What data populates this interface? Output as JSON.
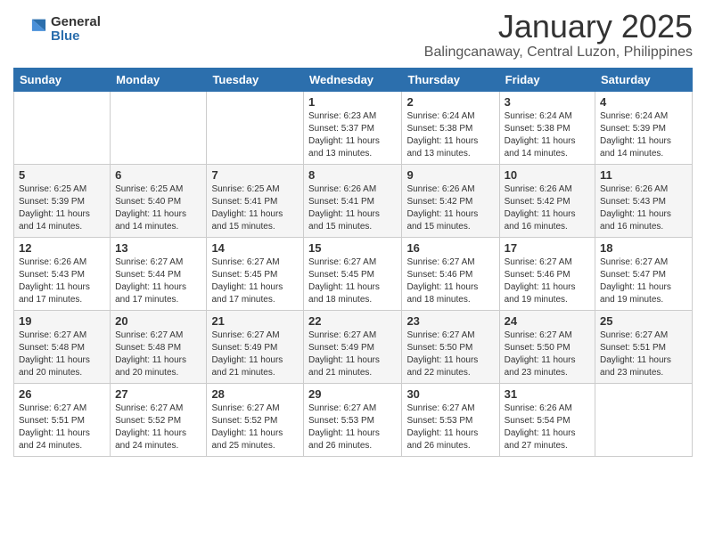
{
  "logo": {
    "general": "General",
    "blue": "Blue"
  },
  "title": "January 2025",
  "subtitle": "Balingcanaway, Central Luzon, Philippines",
  "weekdays": [
    "Sunday",
    "Monday",
    "Tuesday",
    "Wednesday",
    "Thursday",
    "Friday",
    "Saturday"
  ],
  "weeks": [
    [
      {
        "day": "",
        "info": ""
      },
      {
        "day": "",
        "info": ""
      },
      {
        "day": "",
        "info": ""
      },
      {
        "day": "1",
        "info": "Sunrise: 6:23 AM\nSunset: 5:37 PM\nDaylight: 11 hours\nand 13 minutes."
      },
      {
        "day": "2",
        "info": "Sunrise: 6:24 AM\nSunset: 5:38 PM\nDaylight: 11 hours\nand 13 minutes."
      },
      {
        "day": "3",
        "info": "Sunrise: 6:24 AM\nSunset: 5:38 PM\nDaylight: 11 hours\nand 14 minutes."
      },
      {
        "day": "4",
        "info": "Sunrise: 6:24 AM\nSunset: 5:39 PM\nDaylight: 11 hours\nand 14 minutes."
      }
    ],
    [
      {
        "day": "5",
        "info": "Sunrise: 6:25 AM\nSunset: 5:39 PM\nDaylight: 11 hours\nand 14 minutes."
      },
      {
        "day": "6",
        "info": "Sunrise: 6:25 AM\nSunset: 5:40 PM\nDaylight: 11 hours\nand 14 minutes."
      },
      {
        "day": "7",
        "info": "Sunrise: 6:25 AM\nSunset: 5:41 PM\nDaylight: 11 hours\nand 15 minutes."
      },
      {
        "day": "8",
        "info": "Sunrise: 6:26 AM\nSunset: 5:41 PM\nDaylight: 11 hours\nand 15 minutes."
      },
      {
        "day": "9",
        "info": "Sunrise: 6:26 AM\nSunset: 5:42 PM\nDaylight: 11 hours\nand 15 minutes."
      },
      {
        "day": "10",
        "info": "Sunrise: 6:26 AM\nSunset: 5:42 PM\nDaylight: 11 hours\nand 16 minutes."
      },
      {
        "day": "11",
        "info": "Sunrise: 6:26 AM\nSunset: 5:43 PM\nDaylight: 11 hours\nand 16 minutes."
      }
    ],
    [
      {
        "day": "12",
        "info": "Sunrise: 6:26 AM\nSunset: 5:43 PM\nDaylight: 11 hours\nand 17 minutes."
      },
      {
        "day": "13",
        "info": "Sunrise: 6:27 AM\nSunset: 5:44 PM\nDaylight: 11 hours\nand 17 minutes."
      },
      {
        "day": "14",
        "info": "Sunrise: 6:27 AM\nSunset: 5:45 PM\nDaylight: 11 hours\nand 17 minutes."
      },
      {
        "day": "15",
        "info": "Sunrise: 6:27 AM\nSunset: 5:45 PM\nDaylight: 11 hours\nand 18 minutes."
      },
      {
        "day": "16",
        "info": "Sunrise: 6:27 AM\nSunset: 5:46 PM\nDaylight: 11 hours\nand 18 minutes."
      },
      {
        "day": "17",
        "info": "Sunrise: 6:27 AM\nSunset: 5:46 PM\nDaylight: 11 hours\nand 19 minutes."
      },
      {
        "day": "18",
        "info": "Sunrise: 6:27 AM\nSunset: 5:47 PM\nDaylight: 11 hours\nand 19 minutes."
      }
    ],
    [
      {
        "day": "19",
        "info": "Sunrise: 6:27 AM\nSunset: 5:48 PM\nDaylight: 11 hours\nand 20 minutes."
      },
      {
        "day": "20",
        "info": "Sunrise: 6:27 AM\nSunset: 5:48 PM\nDaylight: 11 hours\nand 20 minutes."
      },
      {
        "day": "21",
        "info": "Sunrise: 6:27 AM\nSunset: 5:49 PM\nDaylight: 11 hours\nand 21 minutes."
      },
      {
        "day": "22",
        "info": "Sunrise: 6:27 AM\nSunset: 5:49 PM\nDaylight: 11 hours\nand 21 minutes."
      },
      {
        "day": "23",
        "info": "Sunrise: 6:27 AM\nSunset: 5:50 PM\nDaylight: 11 hours\nand 22 minutes."
      },
      {
        "day": "24",
        "info": "Sunrise: 6:27 AM\nSunset: 5:50 PM\nDaylight: 11 hours\nand 23 minutes."
      },
      {
        "day": "25",
        "info": "Sunrise: 6:27 AM\nSunset: 5:51 PM\nDaylight: 11 hours\nand 23 minutes."
      }
    ],
    [
      {
        "day": "26",
        "info": "Sunrise: 6:27 AM\nSunset: 5:51 PM\nDaylight: 11 hours\nand 24 minutes."
      },
      {
        "day": "27",
        "info": "Sunrise: 6:27 AM\nSunset: 5:52 PM\nDaylight: 11 hours\nand 24 minutes."
      },
      {
        "day": "28",
        "info": "Sunrise: 6:27 AM\nSunset: 5:52 PM\nDaylight: 11 hours\nand 25 minutes."
      },
      {
        "day": "29",
        "info": "Sunrise: 6:27 AM\nSunset: 5:53 PM\nDaylight: 11 hours\nand 26 minutes."
      },
      {
        "day": "30",
        "info": "Sunrise: 6:27 AM\nSunset: 5:53 PM\nDaylight: 11 hours\nand 26 minutes."
      },
      {
        "day": "31",
        "info": "Sunrise: 6:26 AM\nSunset: 5:54 PM\nDaylight: 11 hours\nand 27 minutes."
      },
      {
        "day": "",
        "info": ""
      }
    ]
  ]
}
